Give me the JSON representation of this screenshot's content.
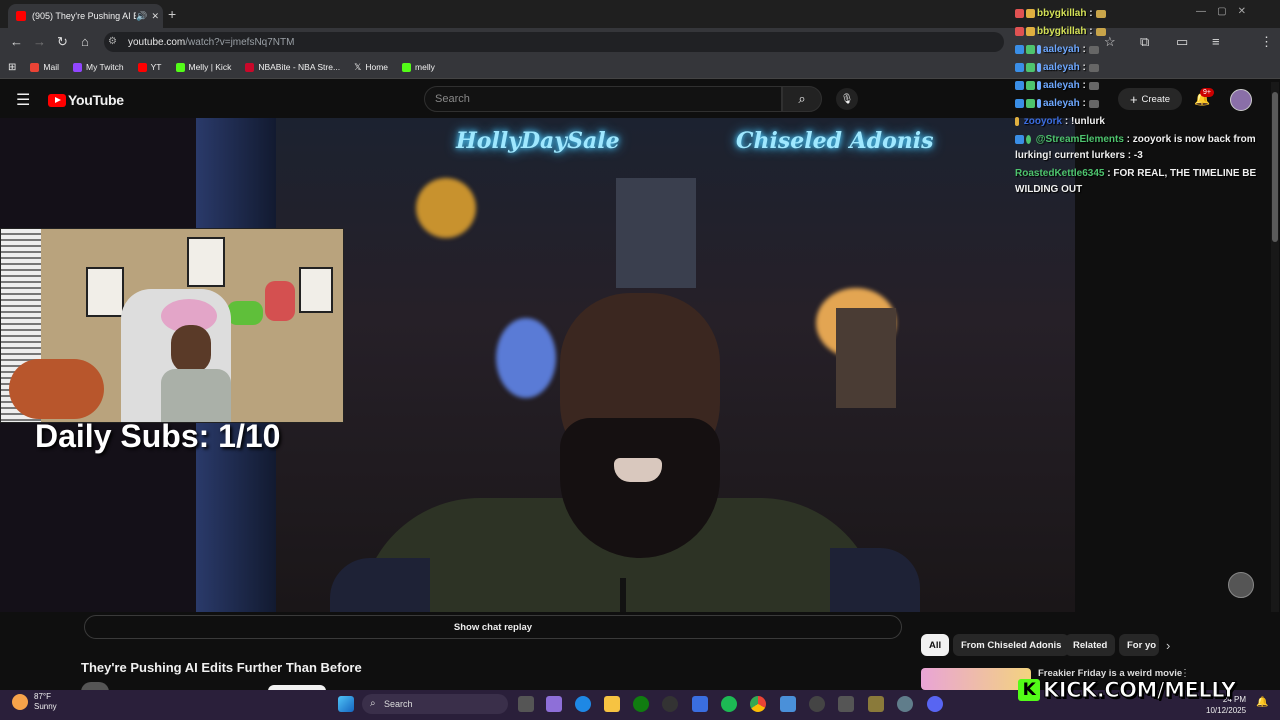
{
  "browser": {
    "tab_title": "(905) They're Pushing AI Edit",
    "url_host": "youtube.com",
    "url_path": "/watch?v=jmefsNq7NTM",
    "bookmarks": [
      {
        "label": "Mail",
        "color": "#ea4335"
      },
      {
        "label": "My Twitch",
        "color": "#9146ff"
      },
      {
        "label": "YT",
        "color": "#ff0000"
      },
      {
        "label": "Melly | Kick",
        "color": "#53fc18"
      },
      {
        "label": "NBABite - NBA Stre...",
        "color": "#c9082a"
      },
      {
        "label": "Home",
        "color": "#ffffff"
      },
      {
        "label": "melly",
        "color": "#53fc18"
      }
    ]
  },
  "youtube": {
    "logo_text": "YouTube",
    "search_placeholder": "Search",
    "create_label": "Create",
    "notification_count": "9+",
    "show_chat_replay": "Show chat replay",
    "video_title": "They're Pushing AI Edits Further Than Before",
    "chips": [
      "All",
      "From Chiseled Adonis",
      "Related",
      "For yo"
    ],
    "related_title": "Freakier Friday is a weird movie"
  },
  "overlay": {
    "daily_subs": "Daily Subs: 1/10",
    "kick_text": "KICK.COM/MELLY",
    "neon_left": "HollyDaySale",
    "neon_right": "Chiseled Adonis"
  },
  "chat": [
    {
      "user": "bbygkillah",
      "text": "",
      "color": "#d4e157"
    },
    {
      "user": "bbygkillah",
      "text": "",
      "color": "#d4e157"
    },
    {
      "user": "aaleyah",
      "text": "",
      "color": "#6ea8ff"
    },
    {
      "user": "aaleyah",
      "text": "",
      "color": "#6ea8ff"
    },
    {
      "user": "aaleyah",
      "text": "",
      "color": "#6ea8ff"
    },
    {
      "user": "aaleyah",
      "text": "",
      "color": "#6ea8ff"
    },
    {
      "user": "zooyork",
      "text": "!unlurk",
      "color": "#3b6de0"
    },
    {
      "user": "@StreamElements",
      "text": "zooyork is now back from",
      "color": "#4ec46e"
    },
    {
      "user": "",
      "text": "lurking! current lurkers : -3",
      "color": "#ffffff"
    },
    {
      "user": "RoastedKettle6345",
      "text": "FOR REAL, THE TIMELINE BE",
      "color": "#4ec46e"
    },
    {
      "user": "",
      "text": "WILDING OUT",
      "color": "#ffffff"
    }
  ],
  "taskbar": {
    "temp": "87°F",
    "condition": "Sunny",
    "search": "Search",
    "time": "24 PM",
    "date": "10/12/2025"
  }
}
